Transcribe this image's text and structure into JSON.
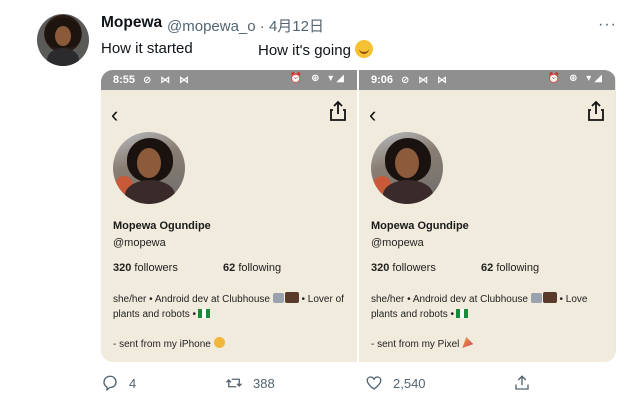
{
  "tweet": {
    "author_name": "Mopewa",
    "author_handle": "@mopewa_o",
    "separator": "·",
    "date": "4月12日",
    "caption_left": "How it started",
    "caption_right": "How it's going",
    "emoji_icon": "smiling-face-emoji",
    "more_icon": "···"
  },
  "screenshots": [
    {
      "time": "8:55",
      "status_icons_left": "⊘ ⋈ ⋈",
      "status_icons_right": "⏰ ⊕ ▾◢",
      "back_glyph": "‹",
      "name": "Mopewa Ogundipe",
      "handle": "@mopewa",
      "followers_count": "320",
      "followers_label": "followers",
      "following_count": "62",
      "following_label": "following",
      "bio_line1_a": "she/her • Android dev at Clubhouse",
      "bio_line1_b": "• Lover of",
      "bio_line2": "plants and robots •",
      "sent_text": "- sent from my iPhone"
    },
    {
      "time": "9:06",
      "status_icons_left": "⊘ ⋈ ⋈",
      "status_icons_right": "⏰ ⊕ ▾◢",
      "back_glyph": "‹",
      "name": "Mopewa Ogundipe",
      "handle": "@mopewa",
      "followers_count": "320",
      "followers_label": "followers",
      "following_count": "62",
      "following_label": "following",
      "bio_line1_a": "she/her • Android dev at Clubhouse",
      "bio_line1_b": "• Love",
      "bio_line2": "plants and robots •",
      "sent_text": "- sent from my Pixel"
    }
  ],
  "actions": {
    "replies": "4",
    "retweets": "388",
    "likes": "2,540"
  },
  "colors": {
    "accent_muted": "#536471",
    "screenshot_bg": "#f0ebdd",
    "statusbar": "#8f8f8f"
  }
}
